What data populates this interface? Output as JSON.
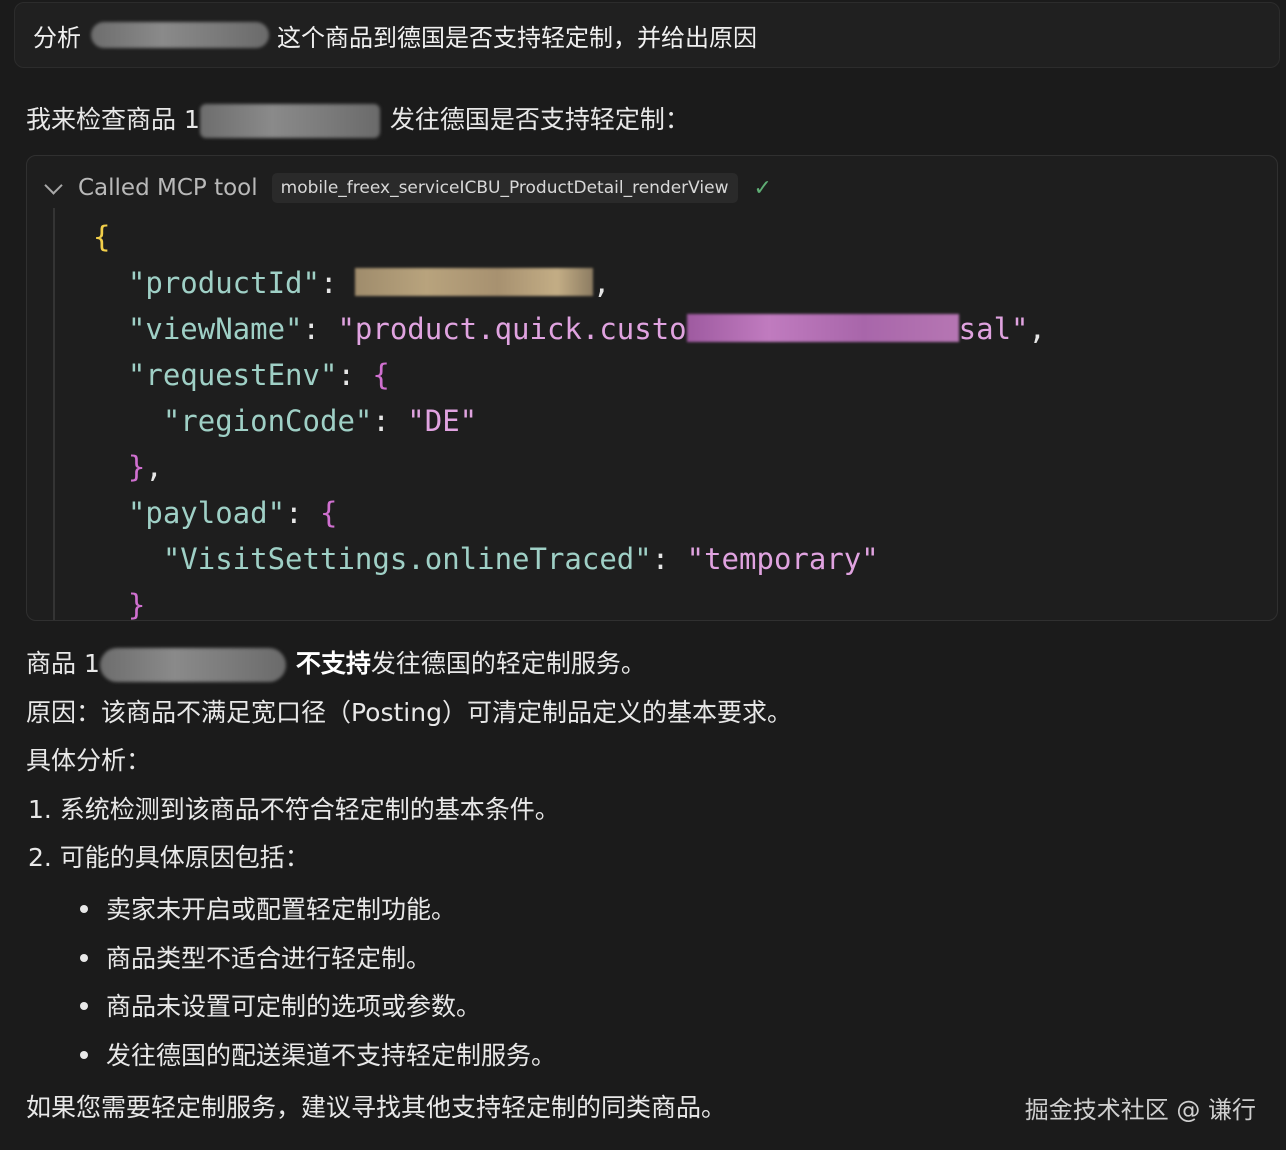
{
  "prompt": {
    "prefix": "分析",
    "suffix": "这个商品到德国是否支持轻定制，并给出原因"
  },
  "intro": {
    "prefix": "我来检查商品 1",
    "suffix": "发往德国是否支持轻定制："
  },
  "tool_call": {
    "label": "Called MCP tool",
    "tool_name": "mobile_freex_serviceICBU_ProductDetail_renderView",
    "status_icon": "check-icon",
    "code": {
      "open_brace": "{",
      "product_id_key": "\"productId\"",
      "view_name_key": "\"viewName\"",
      "view_name_prefix": "\"product.quick.custo",
      "view_name_suffix": "sal\"",
      "request_env_key": "\"requestEnv\"",
      "region_code_key": "\"regionCode\"",
      "region_code_value": "\"DE\"",
      "close_obj": "},",
      "payload_key": "\"payload\"",
      "visit_key": "\"VisitSettings.onlineTraced\"",
      "visit_value": "\"temporary\"",
      "close_inner": "}"
    }
  },
  "answer": {
    "result_prefix": "商品 1",
    "result_bold": "不支持",
    "result_suffix": "发往德国的轻定制服务。",
    "reason": "原因：该商品不满足宽口径（Posting）可清定制品定义的基本要求。",
    "analysis_heading": "具体分析：",
    "steps": [
      "1. 系统检测到该商品不符合轻定制的基本条件。",
      "2. 可能的具体原因包括："
    ],
    "bullets": [
      "卖家未开启或配置轻定制功能。",
      "商品类型不适合进行轻定制。",
      "商品未设置可定制的选项或参数。",
      "发往德国的配送渠道不支持轻定制服务。"
    ],
    "suggestion": "如果您需要轻定制服务，建议寻找其他支持轻定制的同类商品。"
  },
  "watermark": "掘金技术社区 @ 谦行"
}
